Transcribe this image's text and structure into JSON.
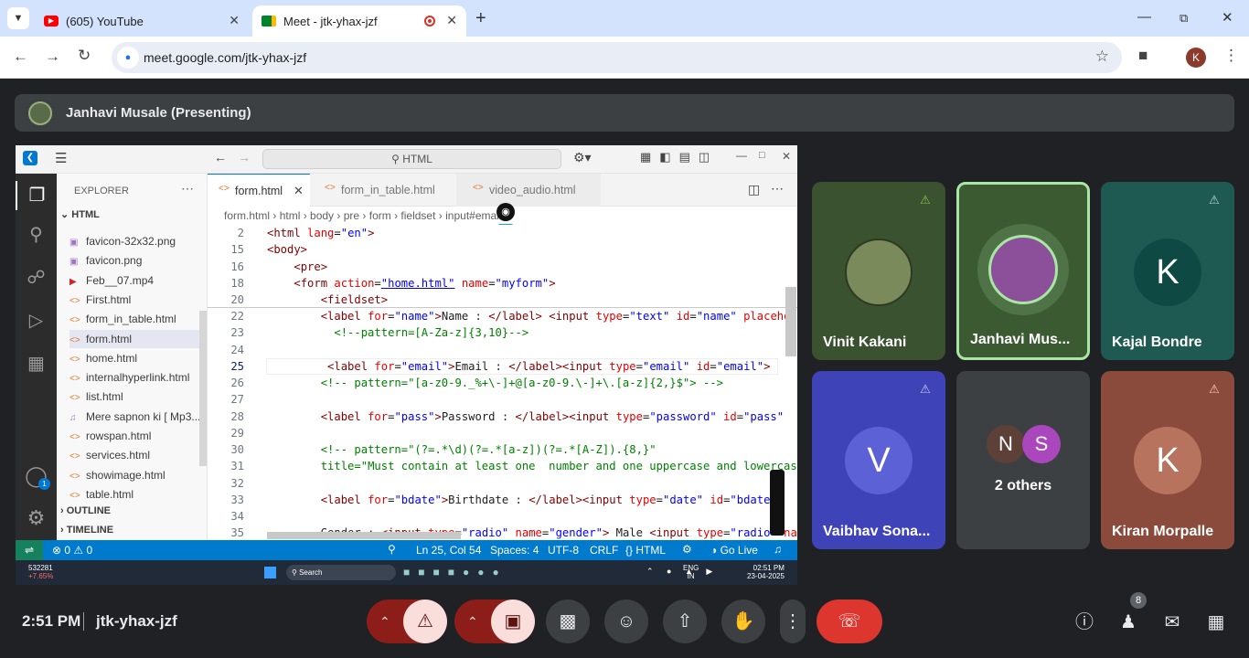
{
  "browser": {
    "tabs": [
      {
        "title": "(605) YouTube"
      },
      {
        "title": "Meet - jtk-yhax-jzf"
      }
    ],
    "url": "meet.google.com/jtk-yhax-jzf",
    "profile_initial": "K"
  },
  "meet": {
    "presenter_label": "Janhavi Musale (Presenting)",
    "time": "2:51 PM",
    "meeting_code": "jtk-yhax-jzf",
    "people_count": "8",
    "participants": [
      {
        "name": "Vinit Kakani",
        "muted": true
      },
      {
        "name": "Janhavi Mus...",
        "muted": false,
        "speaking": true
      },
      {
        "name": "Kajal Bondre",
        "initial": "K",
        "muted": true
      },
      {
        "name": "Vaibhav Sona...",
        "initial": "V",
        "muted": true
      },
      {
        "name": "2 others",
        "initials": [
          "N",
          "S"
        ]
      },
      {
        "name": "Kiran Morpalle",
        "initial": "K",
        "muted": true
      }
    ]
  },
  "vscode": {
    "search": "HTML",
    "explorer_title": "EXPLORER",
    "folder": "HTML",
    "files": [
      "favicon-32x32.png",
      "favicon.png",
      "Feb__07.mp4",
      "First.html",
      "form_in_table.html",
      "form.html",
      "home.html",
      "internalhyperlink.html",
      "list.html",
      "Mere sapnon ki [ Mp3...",
      "rowspan.html",
      "services.html",
      "showimage.html",
      "table.html"
    ],
    "outline": "OUTLINE",
    "timeline": "TIMELINE",
    "account_badge": "1",
    "editor_tabs": [
      "form.html",
      "form_in_table.html",
      "video_audio.html"
    ],
    "breadcrumb": [
      "form.html",
      "html",
      "body",
      "pre",
      "form",
      "fieldset",
      "input#email"
    ],
    "status": {
      "errors": "0",
      "warnings": "0",
      "position": "Ln 25, Col 54",
      "spaces": "Spaces: 4",
      "encoding": "UTF-8",
      "eol": "CRLF",
      "language": "HTML",
      "golive": "Go Live"
    }
  },
  "taskbar": {
    "stock": "532281",
    "stock_change": "+7.65%",
    "search": "Search",
    "lang": "ENG",
    "region": "IN",
    "clock": "02:51 PM",
    "date": "23-04-2025"
  }
}
